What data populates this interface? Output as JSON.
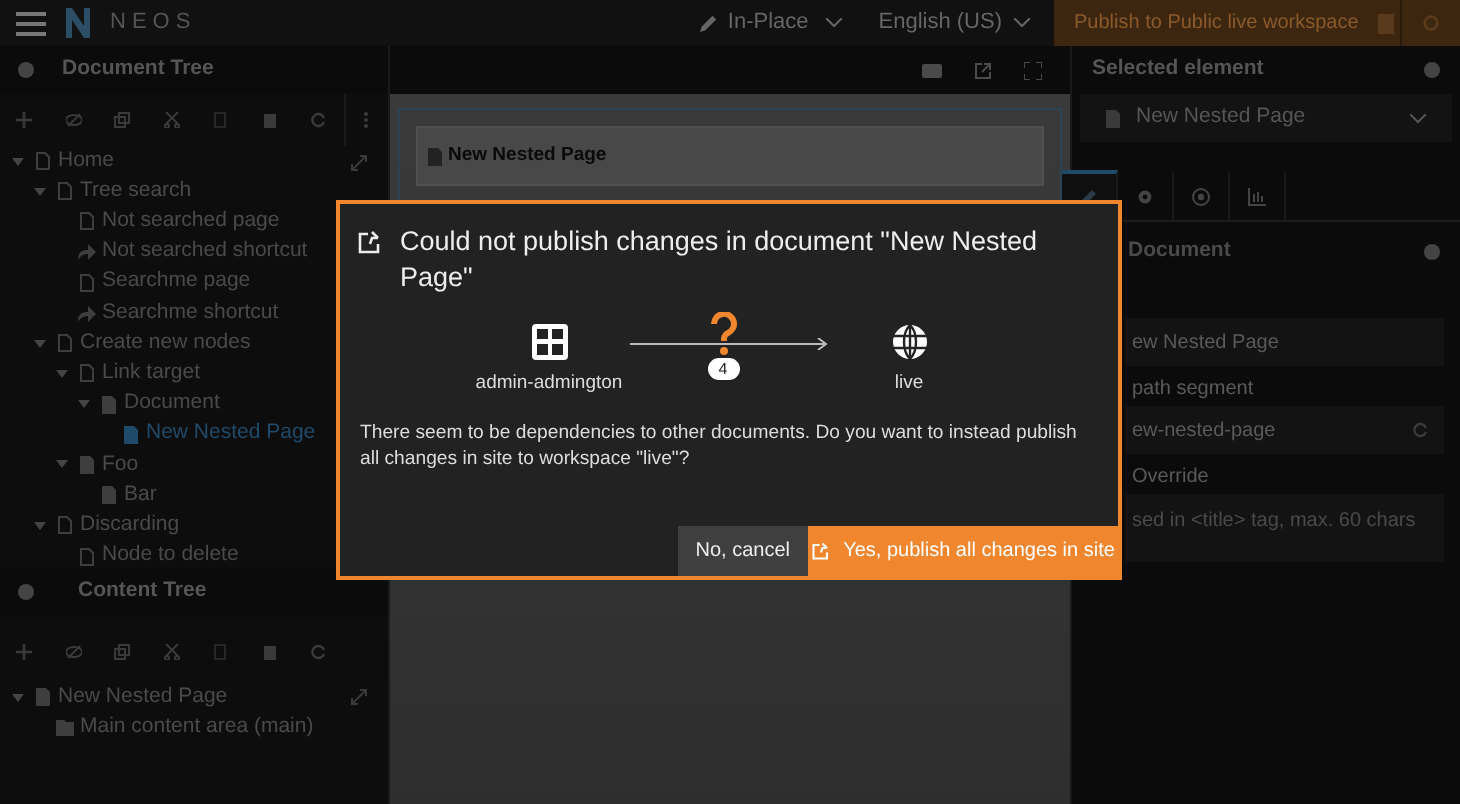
{
  "top_bar": {
    "brand": "NEOS",
    "edit_mode": "In-Place",
    "language": "English (US)",
    "publish_button": "Publish to Public live workspace"
  },
  "document_tree": {
    "title": "Document Tree",
    "items": [
      {
        "label": "Home",
        "kind": "page",
        "expanded": true,
        "selected": false,
        "children": [
          {
            "label": "Tree search",
            "kind": "page",
            "expanded": true,
            "selected": false,
            "children": [
              {
                "label": "Not searched page",
                "kind": "page",
                "selected": false
              },
              {
                "label": "Not searched shortcut",
                "kind": "shortcut",
                "selected": false
              },
              {
                "label": "Searchme page",
                "kind": "page",
                "selected": false
              },
              {
                "label": "Searchme shortcut",
                "kind": "shortcut",
                "selected": false
              }
            ]
          },
          {
            "label": "Create new nodes",
            "kind": "page",
            "expanded": true,
            "selected": false,
            "children": [
              {
                "label": "Link target",
                "kind": "page",
                "expanded": true,
                "selected": false,
                "children": [
                  {
                    "label": "Document",
                    "kind": "filled",
                    "expanded": true,
                    "selected": false,
                    "children": [
                      {
                        "label": "New Nested Page",
                        "kind": "filled",
                        "selected": true
                      }
                    ]
                  }
                ]
              },
              {
                "label": "Foo",
                "kind": "filled",
                "expanded": true,
                "selected": false,
                "children": [
                  {
                    "label": "Bar",
                    "kind": "filled",
                    "selected": false
                  }
                ]
              }
            ]
          },
          {
            "label": "Discarding",
            "kind": "page",
            "expanded": true,
            "selected": false,
            "children": [
              {
                "label": "Node to delete",
                "kind": "page",
                "selected": false
              }
            ]
          }
        ]
      }
    ]
  },
  "content_tree": {
    "title": "Content Tree",
    "items": [
      {
        "label": "New Nested Page",
        "kind": "filled",
        "expanded": true,
        "selected": false,
        "children": [
          {
            "label": "Main content area (main)",
            "kind": "folder",
            "selected": false
          }
        ]
      }
    ]
  },
  "preview": {
    "page_title": "New Nested Page"
  },
  "inspector": {
    "title": "Selected element",
    "selected_node": "New Nested Page",
    "tabs": [
      {
        "kind": "edit",
        "selected": true
      },
      {
        "kind": "gear",
        "selected": false
      },
      {
        "kind": "target",
        "selected": false
      },
      {
        "kind": "chart",
        "selected": false
      }
    ],
    "section": "Document",
    "fields": [
      {
        "value": "ew Nested Page"
      },
      {
        "label": "path segment",
        "value": "ew-nested-page"
      },
      {
        "label": "Override",
        "placeholder": "sed in <title> tag, max. 60 chars"
      }
    ]
  },
  "dialog": {
    "title": "Could not publish changes in document \"New Nested Page\"",
    "source": "admin-admington",
    "count": "4",
    "target": "live",
    "message": "There seem to be dependencies to other documents. Do you want to instead publish all changes in site to workspace \"live\"?",
    "cancel_button": "No, cancel",
    "confirm_button": "Yes, publish all changes in site"
  }
}
